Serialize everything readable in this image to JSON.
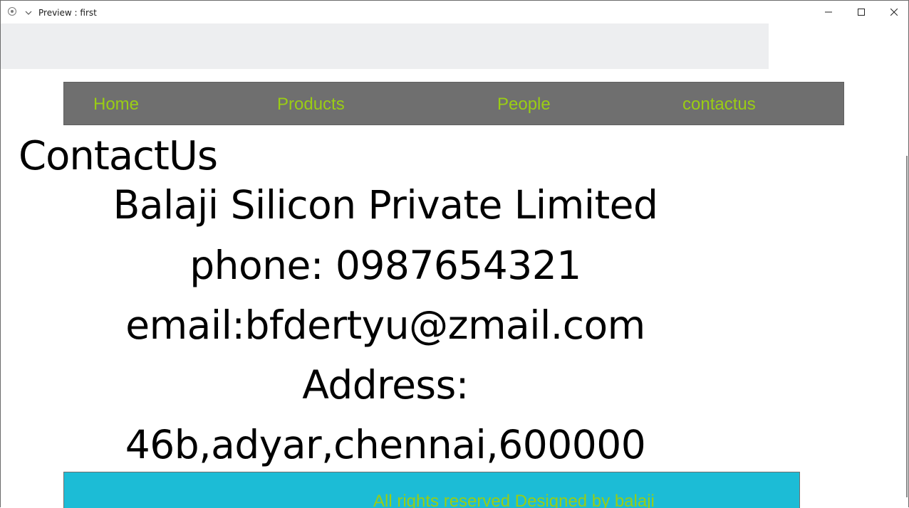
{
  "window": {
    "title": "Preview : first",
    "icons": {
      "app": "record-circle-icon",
      "menu": "chevron-down-icon",
      "minimize": "minimize-icon",
      "maximize": "maximize-icon",
      "close": "close-icon"
    }
  },
  "nav": {
    "items": [
      {
        "label": "Home"
      },
      {
        "label": "Products"
      },
      {
        "label": "People"
      },
      {
        "label": "contactus"
      }
    ]
  },
  "page": {
    "heading": "ContactUs",
    "company": "Balaji Silicon Private Limited",
    "phone": "phone: 0987654321",
    "email": "email:bfdertyu@zmail.com",
    "address_label": "Address:",
    "address": "46b,adyar,chennai,600000"
  },
  "footer": {
    "text": "All rights reserved Designed by balaji"
  },
  "colors": {
    "nav_background": "#6f6f6f",
    "link_color": "#9acd14",
    "footer_background": "#1cbcd6",
    "banner_background": "#edeef0"
  }
}
